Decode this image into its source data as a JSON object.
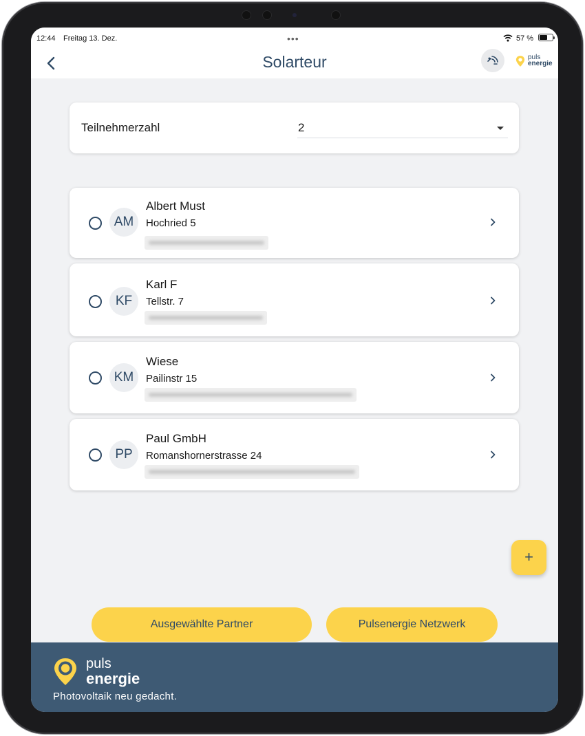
{
  "status_bar": {
    "time": "12:44",
    "date": "Freitag 13. Dez.",
    "dots": "•••",
    "battery": "57 %"
  },
  "nav": {
    "title": "Solarteur",
    "brand_line1": "puls",
    "brand_line2": "energie"
  },
  "participants": {
    "label": "Teilnehmerzahl",
    "value": "2"
  },
  "partners": [
    {
      "initials": "AM",
      "name": "Albert Must",
      "street": "Hochried 5"
    },
    {
      "initials": "KF",
      "name": "Karl F",
      "street": "Tellstr. 7"
    },
    {
      "initials": "KM",
      "name": "Wiese",
      "street": "Pailinstr 15"
    },
    {
      "initials": "PP",
      "name": "Paul GmbH",
      "street": "Romanshornerstrasse 24"
    }
  ],
  "fab_label": "+",
  "buttons": {
    "selected_partners": "Ausgewählte Partner",
    "network": "Pulsenergie Netzwerk"
  },
  "footer": {
    "brand_line1": "puls",
    "brand_line2": "energie",
    "tagline": "Photovoltaik neu gedacht."
  },
  "colors": {
    "accent": "#fcd34b",
    "primary": "#2f4a66",
    "footer_bg": "#3e5a74",
    "background": "#f1f2f4"
  }
}
